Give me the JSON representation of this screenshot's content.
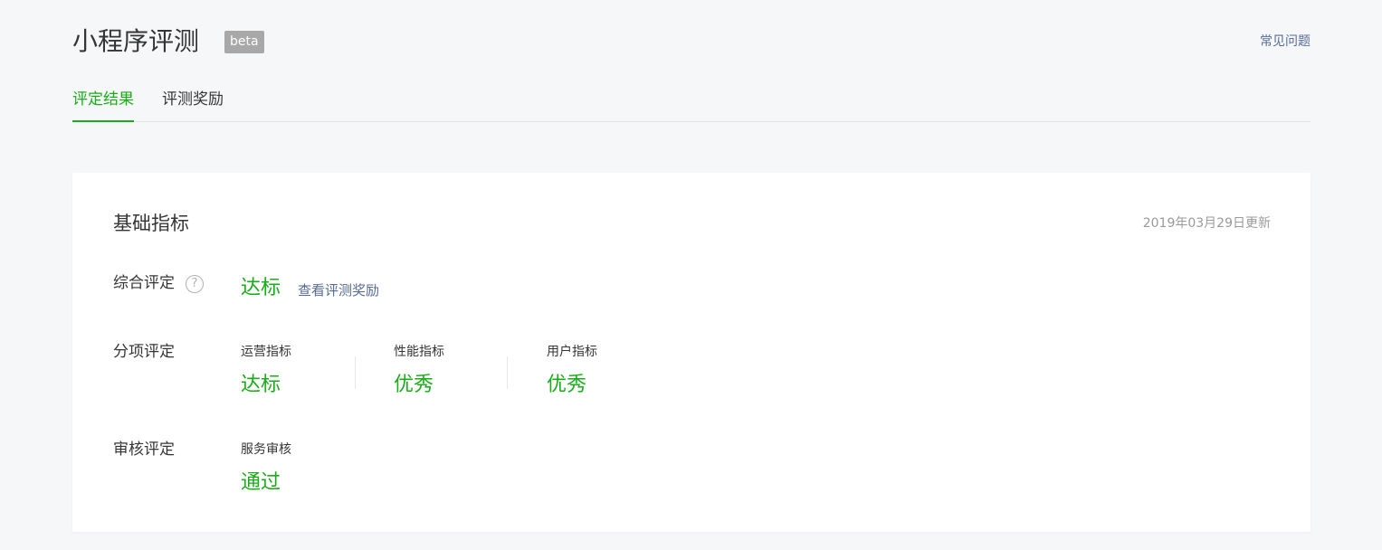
{
  "header": {
    "title": "小程序评测",
    "badge": "beta",
    "faq_link": "常见问题"
  },
  "tabs": [
    {
      "label": "评定结果",
      "active": true
    },
    {
      "label": "评测奖励",
      "active": false
    }
  ],
  "card": {
    "title": "基础指标",
    "updated": "2019年03月29日更新",
    "overall": {
      "label": "综合评定",
      "help_icon": "question-circle-icon",
      "value": "达标",
      "link": "查看评测奖励"
    },
    "breakdown": {
      "label": "分项评定",
      "items": [
        {
          "name": "运营指标",
          "value": "达标"
        },
        {
          "name": "性能指标",
          "value": "优秀"
        },
        {
          "name": "用户指标",
          "value": "优秀"
        }
      ]
    },
    "review": {
      "label": "审核评定",
      "items": [
        {
          "name": "服务审核",
          "value": "通过"
        }
      ]
    }
  },
  "colors": {
    "accent_green": "#1aad19",
    "link_blue": "#576b95",
    "background": "#f6f7f9"
  }
}
